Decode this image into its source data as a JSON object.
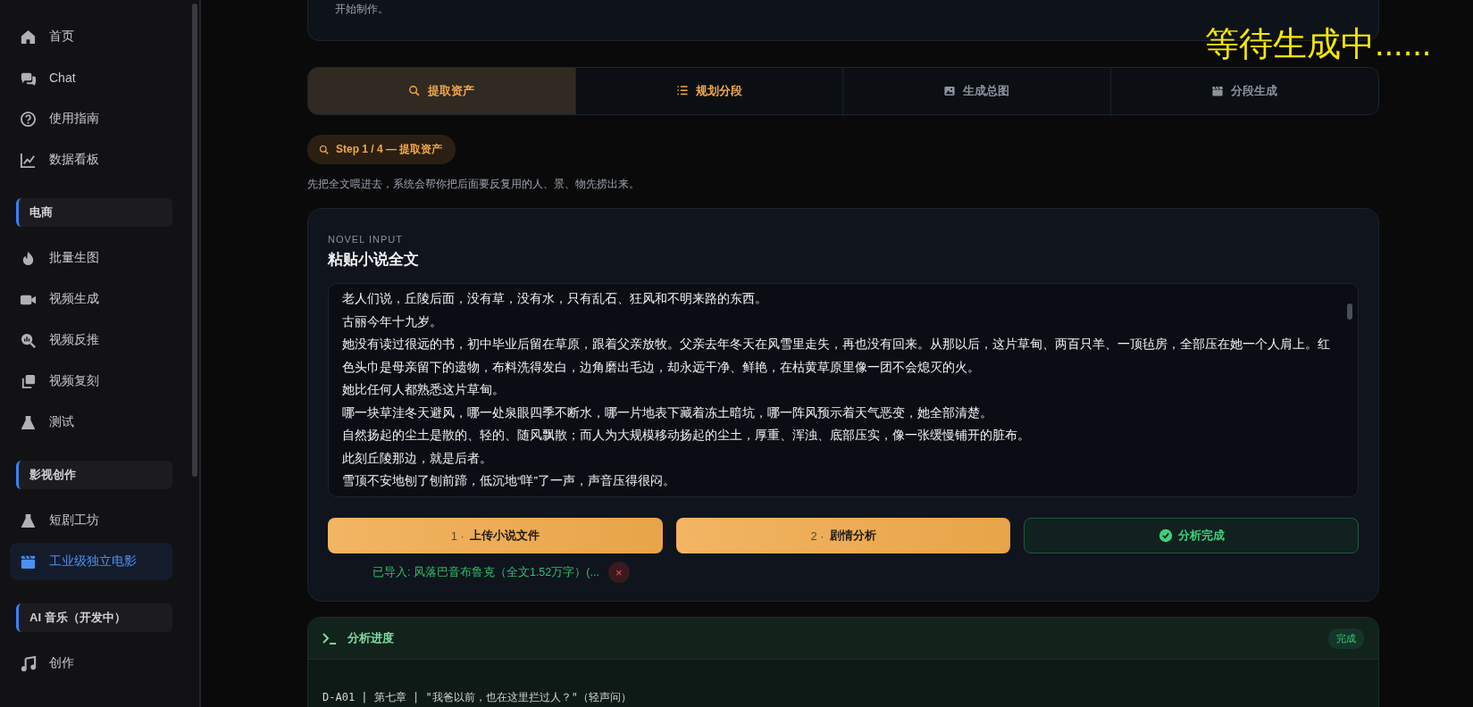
{
  "sidebar": {
    "items": [
      {
        "kind": "link",
        "label": "首页",
        "selected": false
      },
      {
        "kind": "link",
        "label": "Chat",
        "selected": false
      },
      {
        "kind": "link",
        "label": "使用指南",
        "selected": false
      },
      {
        "kind": "link",
        "label": "数据看板",
        "selected": false
      },
      {
        "kind": "section",
        "label": "电商"
      },
      {
        "kind": "link",
        "label": "批量生图",
        "selected": false
      },
      {
        "kind": "link",
        "label": "视频生成",
        "selected": false
      },
      {
        "kind": "link",
        "label": "视频反推",
        "selected": false
      },
      {
        "kind": "link",
        "label": "视频复刻",
        "selected": false
      },
      {
        "kind": "link",
        "label": "测试",
        "selected": false
      },
      {
        "kind": "section",
        "label": "影视创作"
      },
      {
        "kind": "link",
        "label": "短剧工坊",
        "selected": false
      },
      {
        "kind": "link",
        "label": "工业级独立电影",
        "selected": true
      },
      {
        "kind": "section",
        "label": "AI 音乐（开发中）"
      },
      {
        "kind": "link",
        "label": "创作",
        "selected": false
      }
    ]
  },
  "intro_card": {
    "text": "开始制作。"
  },
  "overlay_status": "等待生成中......",
  "tabs": [
    {
      "label": "提取资产",
      "selected": true,
      "unlocked": true
    },
    {
      "label": "规划分段",
      "selected": false,
      "unlocked": true
    },
    {
      "label": "生成总图",
      "selected": false,
      "unlocked": false
    },
    {
      "label": "分段生成",
      "selected": false,
      "unlocked": false
    }
  ],
  "step_badge": "Step 1 / 4 — 提取资产",
  "step_description": "先把全文喂进去，系统会帮你把后面要反复用的人、景、物先捞出来。",
  "novel_card": {
    "eyebrow": "NOVEL INPUT",
    "title": "粘贴小说全文",
    "text_lines": [
      "老人们说，丘陵后面，没有草，没有水，只有乱石、狂风和不明来路的东西。",
      "古丽今年十九岁。",
      "她没有读过很远的书，初中毕业后留在草原，跟着父亲放牧。父亲去年冬天在风雪里走失，再也没有回来。从那以后，这片草甸、两百只羊、一顶毡房，全部压在她一个人肩上。红色头巾是母亲留下的遗物，布料洗得发白，边角磨出毛边，却永远干净、鲜艳，在枯黄草原里像一团不会熄灭的火。",
      "她比任何人都熟悉这片草甸。",
      "哪一块草洼冬天避风，哪一处泉眼四季不断水，哪一片地表下藏着冻土暗坑，哪一阵风预示着天气恶变，她全部清楚。",
      "自然扬起的尘土是散的、轻的、随风飘散；而人为大规模移动扬起的尘土，厚重、浑浊、底部压实，像一张缓慢铺开的脏布。",
      "此刻丘陵那边，就是后者。",
      "雪顶不安地刨了刨前蹄，低沉地“咩”了一声，声音压得很闷。"
    ],
    "buttons": [
      {
        "kind": "primary",
        "number": "1 ·",
        "label": "上传小说文件"
      },
      {
        "kind": "primary",
        "number": "2 ·",
        "label": "剧情分析"
      },
      {
        "kind": "done",
        "label": "分析完成"
      }
    ],
    "imported": "已导入: 风落巴音布鲁克（全文1.52万字）(...",
    "remove_label": "×"
  },
  "progress_card": {
    "title": "分析进度",
    "status": "完成",
    "log_lines": [
      "D-A01 | 第七章 | \"我爸以前，也在这里拦过人？\"（轻声问）"
    ]
  }
}
